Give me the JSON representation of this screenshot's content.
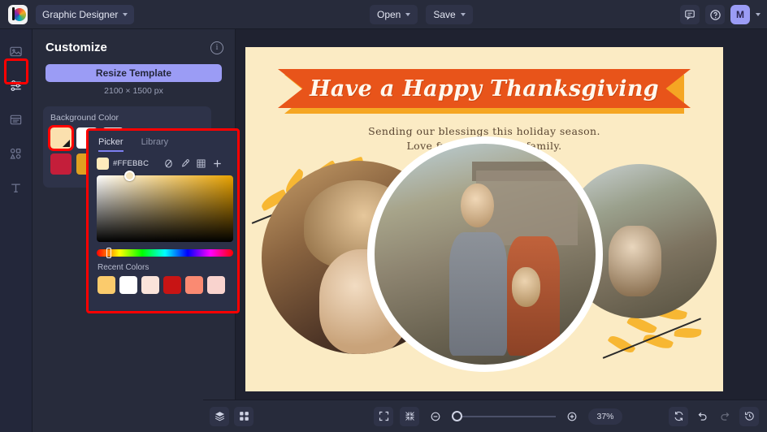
{
  "topbar": {
    "logo_icon": "app-logo-icon",
    "document_type": "Graphic Designer",
    "open_label": "Open",
    "save_label": "Save",
    "comments_icon": "comment-icon",
    "help_icon": "help-circle-icon",
    "avatar_initial": "M"
  },
  "rail": {
    "items": [
      {
        "icon": "image-icon",
        "name": "sidebar-item-images"
      },
      {
        "icon": "sliders-icon",
        "name": "sidebar-item-customize"
      },
      {
        "icon": "text-block-icon",
        "name": "sidebar-item-layouts"
      },
      {
        "icon": "shapes-icon",
        "name": "sidebar-item-elements"
      },
      {
        "icon": "text-icon",
        "name": "sidebar-item-text"
      }
    ]
  },
  "panel": {
    "title": "Customize",
    "info_icon": "info-icon",
    "resize_label": "Resize Template",
    "dimensions": "2100 × 1500 px",
    "background_color_label": "Background Color",
    "swatches_row1": [
      "#FBE0AE",
      "#FFFFFF",
      "#F1F0EE",
      "#2D3142"
    ],
    "swatches_row2": [
      "#C41E3A",
      "#E0A020",
      "#6E4B2A",
      "#3E4250"
    ]
  },
  "picker": {
    "tab_picker": "Picker",
    "tab_library": "Library",
    "hex_value": "#FFEBBC",
    "hex_color": "#FFEBBC",
    "tools": [
      {
        "icon": "no-color-icon",
        "name": "no-color-button"
      },
      {
        "icon": "eyedropper-icon",
        "name": "eyedropper-button"
      },
      {
        "icon": "palette-grid-icon",
        "name": "palette-grid-button"
      },
      {
        "icon": "plus-icon",
        "name": "add-color-button"
      }
    ],
    "recent_colors_label": "Recent Colors",
    "recent_colors": [
      "#FBCB6C",
      "#FFFFFF",
      "#FAE3DA",
      "#C81414",
      "#FA8A72",
      "#F9D3CE"
    ]
  },
  "canvas": {
    "background_color": "#FBEBC4",
    "banner_text": "Have a Happy Thanksgiving",
    "banner_color": "#E8541A",
    "banner_shadow_color": "#F5A623",
    "subtitle_line1": "Sending our blessings this holiday season.",
    "subtitle_line2": "Love from the Clarke family."
  },
  "bottom": {
    "layers_icon": "layers-icon",
    "grid_icon": "grid-view-icon",
    "fit_icon": "fit-screen-icon",
    "collapse_icon": "collapse-icon",
    "zoom_out_icon": "zoom-out-icon",
    "zoom_in_icon": "zoom-in-icon",
    "zoom_level": "37%",
    "reset_icon": "reset-icon",
    "undo_icon": "undo-icon",
    "redo_icon": "redo-icon",
    "history_icon": "history-icon"
  }
}
